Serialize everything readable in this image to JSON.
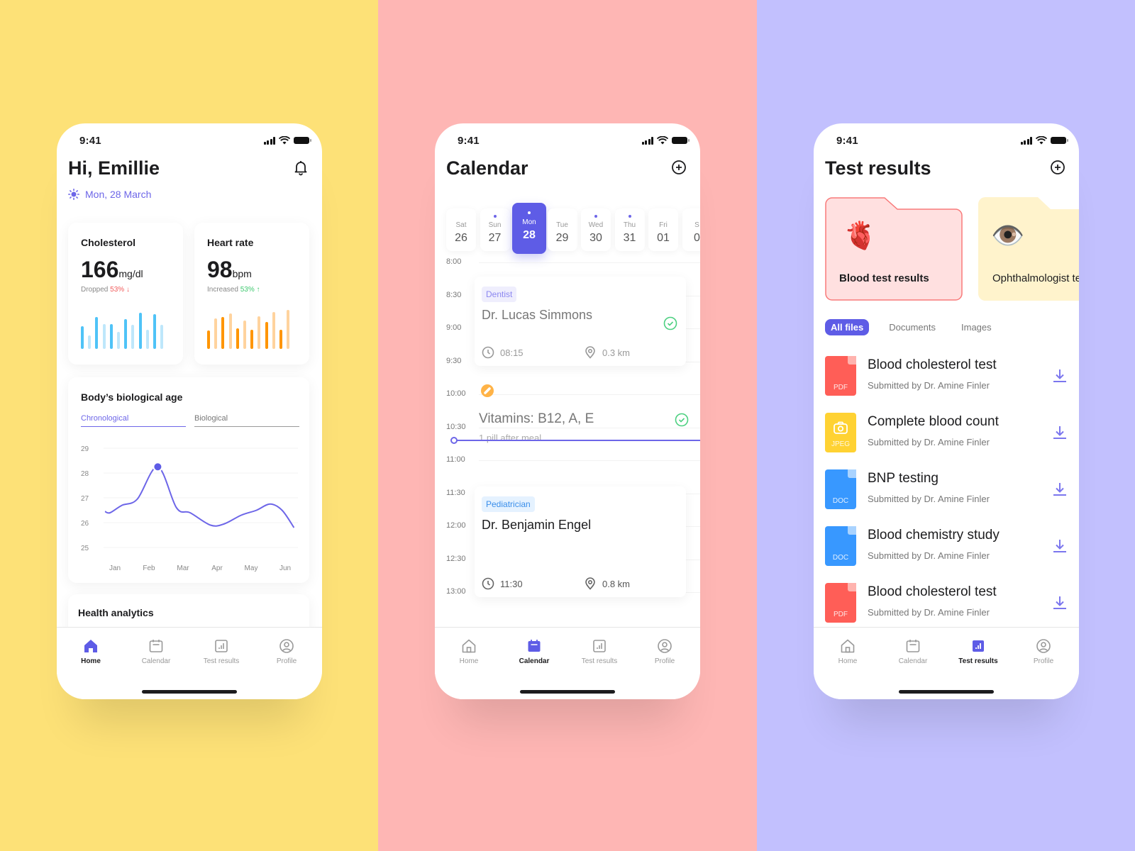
{
  "backgrounds": {
    "left": "#FDE177",
    "middle": "#FEB6B4",
    "right": "#C2C0FE"
  },
  "accent": "#5E5CE6",
  "status_bar": {
    "time": "9:41"
  },
  "home": {
    "title": "Hi, Emillie",
    "date": "Mon, 28 March",
    "cholesterol": {
      "title": "Cholesterol",
      "value": "166",
      "unit": "mg/dl",
      "change_label": "Dropped",
      "change_value": "53%",
      "direction": "down",
      "bars": [
        0.55,
        0.33,
        0.78,
        0.6,
        0.6,
        0.42,
        0.72,
        0.58,
        0.88,
        0.47,
        0.84,
        0.58
      ],
      "color_dark": "#4FC3F7",
      "color_light": "#BEE7FB"
    },
    "heart_rate": {
      "title": "Heart rate",
      "value": "98",
      "unit": "bpm",
      "change_label": "Increased",
      "change_value": "53%",
      "direction": "up",
      "bars": [
        0.45,
        0.74,
        0.78,
        0.86,
        0.5,
        0.69,
        0.46,
        0.8,
        0.66,
        0.9,
        0.47,
        0.95
      ],
      "color_dark": "#FF9500",
      "color_light": "#FFD39E"
    },
    "bio_age": {
      "title": "Body’s biological age",
      "tabs": [
        "Chronological",
        "Biological"
      ],
      "active_tab": 0
    },
    "analytics_title": "Health analytics"
  },
  "chart_data": {
    "type": "line",
    "title": "Body’s biological age",
    "x": [
      "Jan",
      "Feb",
      "Mar",
      "Apr",
      "May",
      "Jun"
    ],
    "yticks": [
      29,
      28,
      27,
      26,
      25
    ],
    "ylim": [
      25,
      29
    ],
    "series": [
      {
        "name": "Chronological",
        "points": [
          [
            0.0,
            26.45
          ],
          [
            0.15,
            26.4
          ],
          [
            0.5,
            26.7
          ],
          [
            0.95,
            26.95
          ],
          [
            1.55,
            28.25
          ],
          [
            2.1,
            26.6
          ],
          [
            2.5,
            26.4
          ],
          [
            3.1,
            25.9
          ],
          [
            3.5,
            25.95
          ],
          [
            4.0,
            26.3
          ],
          [
            4.45,
            26.5
          ],
          [
            4.85,
            26.75
          ],
          [
            5.2,
            26.5
          ],
          [
            5.55,
            25.8
          ]
        ],
        "highlight": [
          1.55,
          28.25
        ]
      }
    ],
    "grid": true
  },
  "calendar": {
    "title": "Calendar",
    "days": [
      {
        "name": "Sat",
        "num": "26",
        "dot": false
      },
      {
        "name": "Sun",
        "num": "27",
        "dot": true
      },
      {
        "name": "Mon",
        "num": "28",
        "dot": true,
        "active": true
      },
      {
        "name": "Tue",
        "num": "29",
        "dot": false
      },
      {
        "name": "Wed",
        "num": "30",
        "dot": true
      },
      {
        "name": "Thu",
        "num": "31",
        "dot": true
      },
      {
        "name": "Fri",
        "num": "01",
        "dot": false
      },
      {
        "name": "S",
        "num": "0",
        "dot": false
      }
    ],
    "times": [
      "8:00",
      "8:30",
      "9:00",
      "9:30",
      "10:00",
      "10:30",
      "11:00",
      "11:30",
      "12:00",
      "12:30",
      "13:00"
    ],
    "events": [
      {
        "tag": "Dentist",
        "title": "Dr. Lucas Simmons",
        "time": "08:15",
        "distance": "0.3 km",
        "done": true
      },
      {
        "title": "Vitamins: B12, A, E",
        "note": "1 pill after meal",
        "done": true
      },
      {
        "tag": "Pediatrician",
        "title": "Dr. Benjamin Engel",
        "time": "11:30",
        "distance": "0.8 km",
        "done": false
      }
    ]
  },
  "test_results": {
    "title": "Test results",
    "folders": [
      {
        "name": "Blood test results",
        "emoji": "🫀",
        "bg": "#FFE0E0",
        "border": "#F87A7A"
      },
      {
        "name": "Ophthalmologist tests",
        "emoji": "👁️",
        "bg": "#FFF3CC",
        "border": "none"
      }
    ],
    "filters": [
      "All files",
      "Documents",
      "Images"
    ],
    "active_filter": 0,
    "files": [
      {
        "name": "Blood cholesterol test",
        "submitter": "Submitted by Dr. Amine Finler",
        "type": "PDF",
        "color": "#FF5E57"
      },
      {
        "name": "Complete blood count",
        "submitter": "Submitted by Dr. Amine Finler",
        "type": "JPEG",
        "color": "#FFD233"
      },
      {
        "name": "BNP testing",
        "submitter": "Submitted by Dr. Amine Finler",
        "type": "DOC",
        "color": "#3898FF"
      },
      {
        "name": "Blood chemistry study",
        "submitter": "Submitted by Dr. Amine Finler",
        "type": "DOC",
        "color": "#3898FF"
      },
      {
        "name": "Blood cholesterol test",
        "submitter": "Submitted by Dr. Amine Finler",
        "type": "PDF",
        "color": "#FF5E57"
      }
    ]
  },
  "tabbar": {
    "items": [
      "Home",
      "Calendar",
      "Test results",
      "Profile"
    ]
  }
}
